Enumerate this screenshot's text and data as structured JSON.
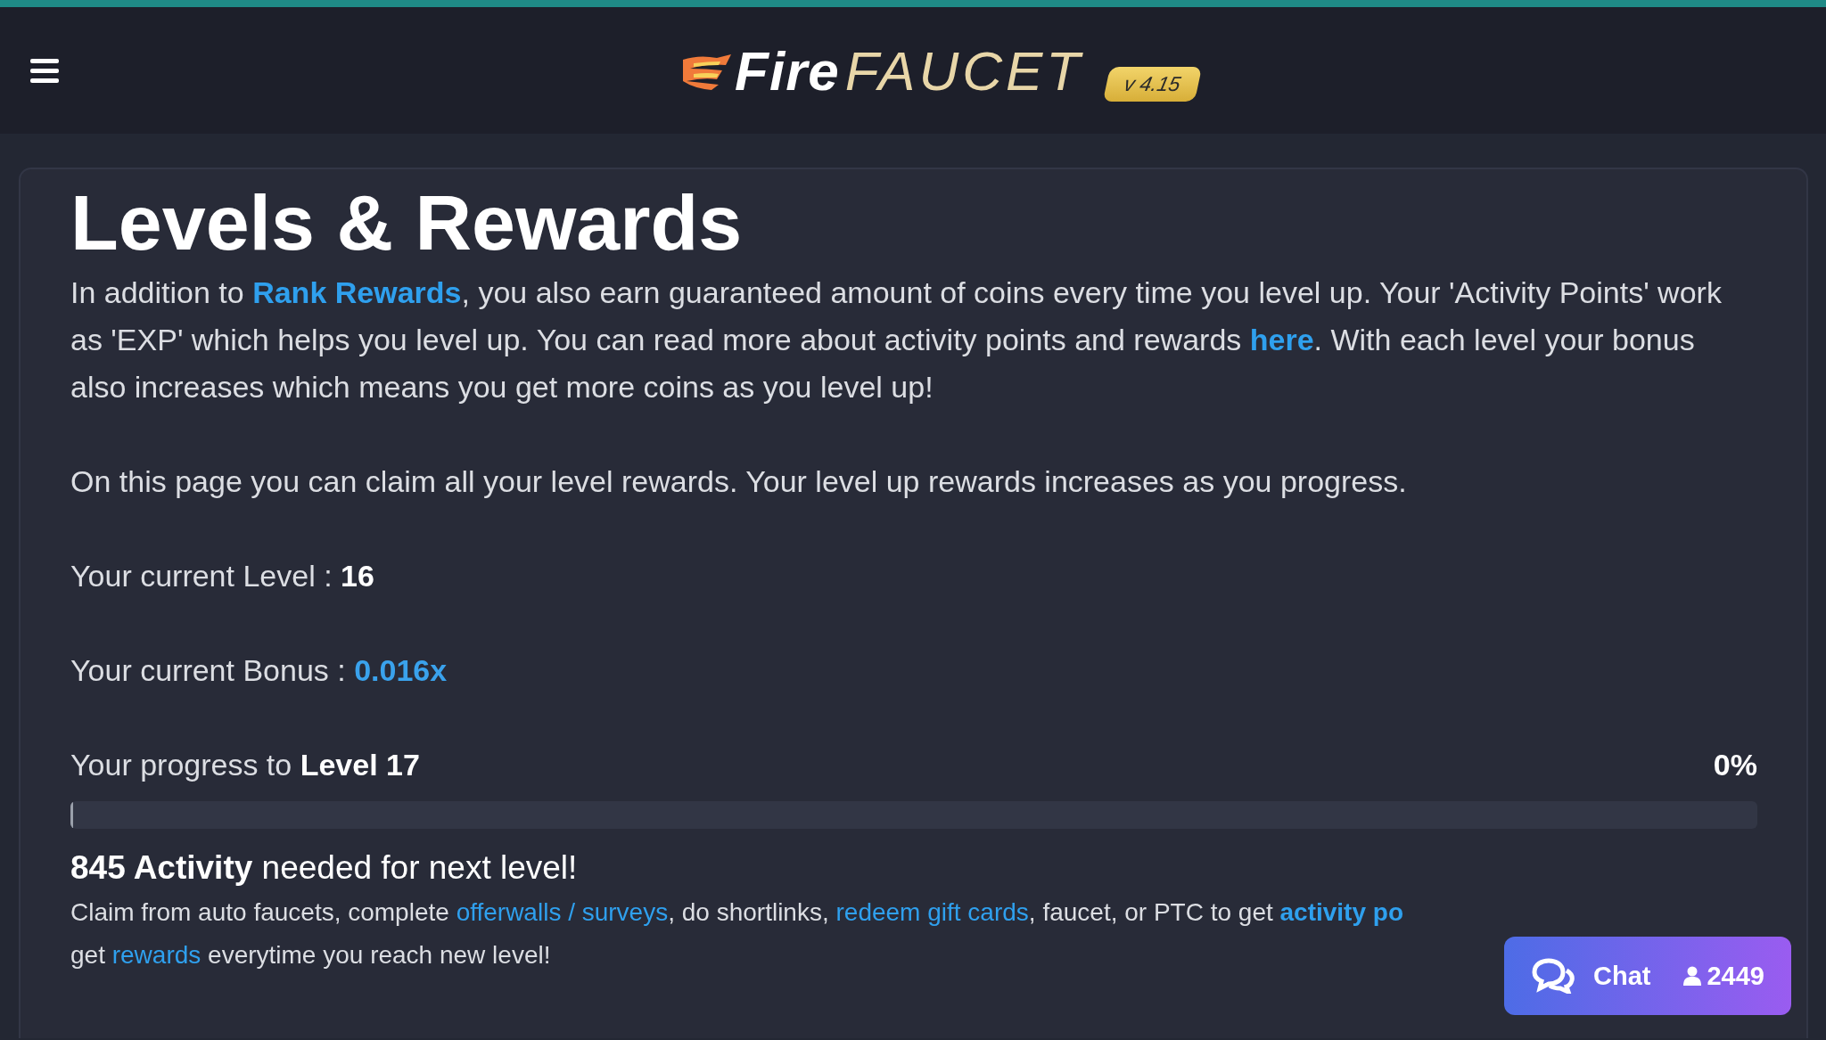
{
  "header": {
    "logo": {
      "part_1": "Fire",
      "part_2": "FAUCET"
    },
    "version": "v 4.15"
  },
  "page": {
    "title": "Levels & Rewards",
    "paragraphs": [
      [
        {
          "kind": "text",
          "text": "In addition to "
        },
        {
          "kind": "strong-link",
          "text": "Rank Rewards"
        },
        {
          "kind": "text",
          "text": ", you also earn guaranteed amount of coins every time you level up. Your 'Activity Points' work as 'EXP' which helps you level up. You can read more about activity points and rewards "
        },
        {
          "kind": "strong-link",
          "text": "here"
        },
        {
          "kind": "text",
          "text": ". With each level your bonus also increases which means you get more coins as you level up!"
        }
      ],
      [
        {
          "kind": "text",
          "text": "On this page you can claim all your level rewards. Your level up rewards increases as you progress."
        }
      ]
    ],
    "current_level": {
      "label": "Your current Level : ",
      "value": "16"
    },
    "current_bonus": {
      "label": "Your current Bonus : ",
      "value": "0.016x"
    },
    "progress": {
      "label": "Your progress to ",
      "target": "Level 17",
      "percent": "0%",
      "level": 0
    },
    "needed": {
      "amount": "845 Activity",
      "text": " needed for next level!"
    },
    "claim_lines": [
      [
        {
          "kind": "text",
          "text": "Claim from auto faucets, complete "
        },
        {
          "kind": "link",
          "text": "offerwalls / surveys"
        },
        {
          "kind": "text",
          "text": ", do shortlinks, "
        },
        {
          "kind": "link",
          "text": "redeem gift cards"
        },
        {
          "kind": "text",
          "text": ", faucet, or PTC to get "
        },
        {
          "kind": "strong-link",
          "text": "activity po"
        }
      ],
      [
        {
          "kind": "text",
          "text": "get "
        },
        {
          "kind": "link",
          "text": "rewards"
        },
        {
          "kind": "text",
          "text": " everytime you reach new level!"
        }
      ]
    ]
  },
  "chat": {
    "label": "Chat",
    "users": "2449"
  }
}
